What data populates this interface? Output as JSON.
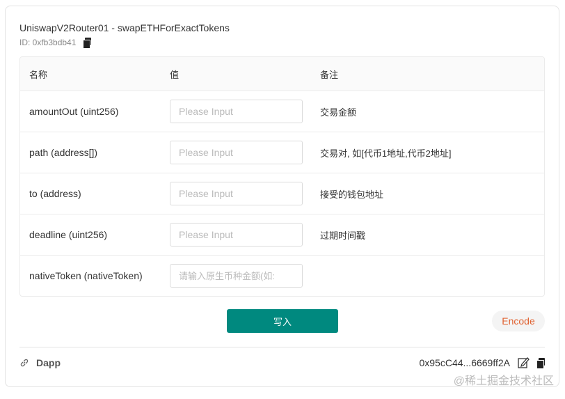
{
  "title": "UniswapV2Router01 - swapETHForExactTokens",
  "id_label": "ID: 0xfb3bdb41",
  "table": {
    "headers": [
      "名称",
      "值",
      "备注"
    ],
    "rows": [
      {
        "name": "amountOut (uint256)",
        "placeholder": "Please Input",
        "value": "",
        "note": "交易金额"
      },
      {
        "name": "path (address[])",
        "placeholder": "Please Input",
        "value": "",
        "note": "交易对, 如[代币1地址,代币2地址]"
      },
      {
        "name": "to (address)",
        "placeholder": "Please Input",
        "value": "",
        "note": "接受的钱包地址"
      },
      {
        "name": "deadline (uint256)",
        "placeholder": "Please Input",
        "value": "",
        "note": "过期时间戳"
      },
      {
        "name": "nativeToken (nativeToken)",
        "placeholder": "请输入原生币种金额(如:",
        "value": "",
        "note": ""
      }
    ]
  },
  "write_label": "写入",
  "encode_label": "Encode",
  "footer": {
    "dapp_label": "Dapp",
    "address": "0x95cC44...6669ff2A"
  },
  "watermark": "@稀土掘金技术社区",
  "colors": {
    "primary": "#00897f",
    "encode": "#e0602f"
  }
}
